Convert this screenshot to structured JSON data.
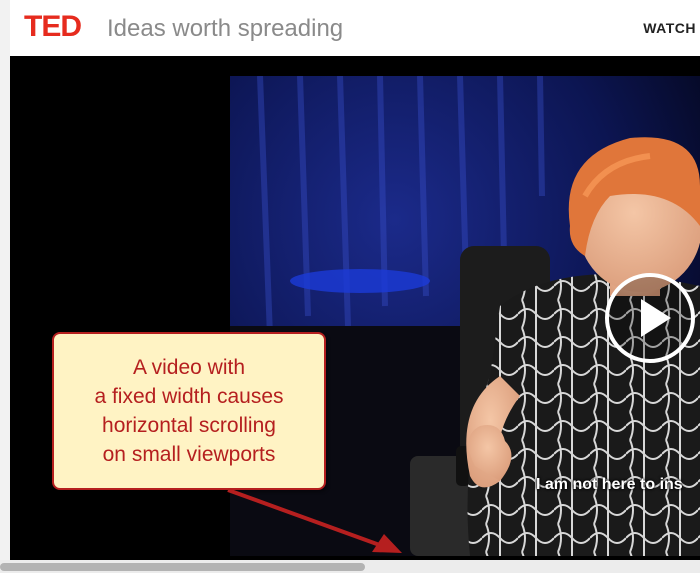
{
  "header": {
    "logo": "TED",
    "tagline": "Ideas worth spreading",
    "nav_watch": "WATCH"
  },
  "video": {
    "subtitle": "I am not here to ins",
    "play_icon": "play-icon"
  },
  "callout": {
    "text": "A video with\na fixed width causes\nhorizontal scrolling\non small viewports"
  },
  "colors": {
    "ted_red": "#e62b1e",
    "callout_border": "#b51f1f",
    "callout_fill": "#fff3c4"
  }
}
